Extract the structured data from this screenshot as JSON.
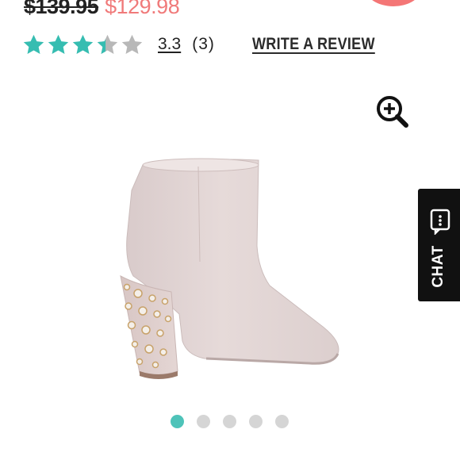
{
  "price": {
    "original": "$139.95",
    "sale": "$129.98"
  },
  "rating": {
    "value": "3.3",
    "count": "(3)",
    "stars_out_of": 5,
    "stars_filled": 3.3,
    "star_color": "#36bdb1",
    "star_empty_color": "#b8b8b8"
  },
  "write_review_label": "WRITE A REVIEW",
  "zoom_icon": "zoom-in-icon",
  "chat": {
    "label": "CHAT",
    "icon": "chat-icon"
  },
  "product": {
    "image_subject": "pink suede ankle boot with pearl-studded block heel"
  },
  "carousel": {
    "total": 5,
    "active_index": 0,
    "active_color": "#4ec3b9",
    "inactive_color": "#d5d5d5"
  },
  "colors": {
    "sale_price": "#f07a7a",
    "cart_badge": "#f47676"
  }
}
